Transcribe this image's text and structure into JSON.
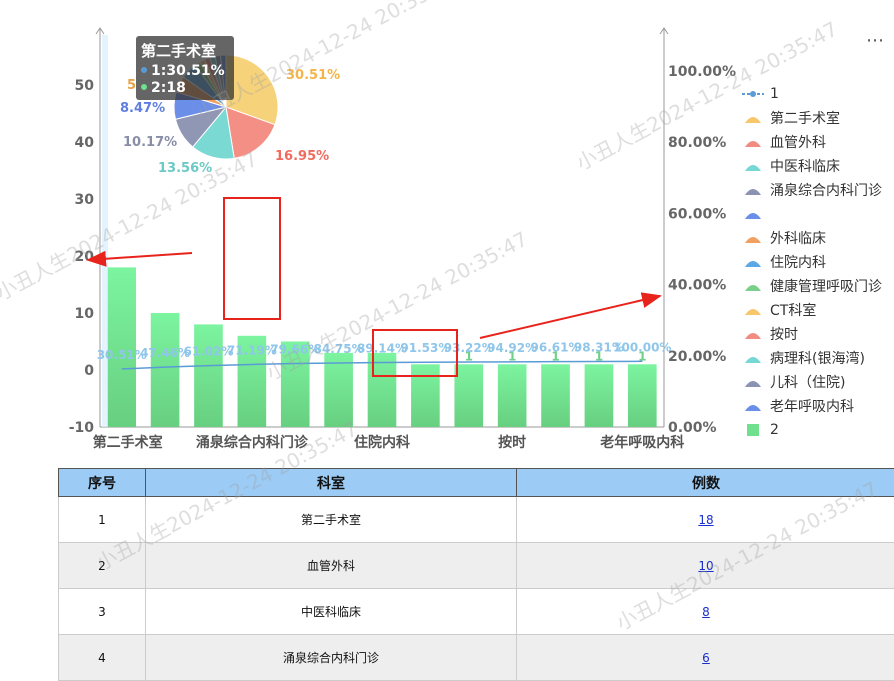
{
  "chart_data": {
    "type": "bar",
    "categories": [
      "第二手术室",
      "血管外科",
      "中医科临床",
      "涌泉综合内科门诊",
      "",
      "外科临床",
      "住院内科",
      "健康管理呼吸门诊",
      "CT科室",
      "按时",
      "病理科(银海湾)",
      "儿科（住院)",
      "老年呼吸内科"
    ],
    "x_tick_labels": [
      "第二手术室",
      "涌泉综合内科门诊",
      "住院内科",
      "按时",
      "老年呼吸内科"
    ],
    "series": [
      {
        "name": "1",
        "type": "line",
        "values": [
          30.51,
          47.46,
          61.02,
          71.19,
          79.66,
          84.75,
          89.14,
          91.53,
          93.22,
          94.92,
          96.61,
          98.31,
          100.0
        ],
        "labels": [
          "30.51%",
          "47.46%",
          "61.02%",
          "71.19%",
          "79.66%",
          "84.75%",
          "89.14%",
          "91.53%",
          "93.22%",
          "94.92%",
          "96.61%",
          "98.31%",
          "100.00%"
        ]
      },
      {
        "name": "2",
        "type": "bar",
        "values": [
          18,
          10,
          8,
          6,
          5,
          3,
          3,
          1,
          1,
          1,
          1,
          1,
          1
        ],
        "top_labels": [
          "",
          "",
          "",
          "",
          "",
          "",
          "",
          "",
          "1",
          "1",
          "1",
          "1",
          "1"
        ]
      }
    ],
    "y_left": {
      "ticks": [
        "-10",
        "0",
        "10",
        "20",
        "30",
        "40",
        "50"
      ],
      "min": -10,
      "max": 55
    },
    "y_right": {
      "ticks": [
        "0.00%",
        "20.00%",
        "40.00%",
        "60.00%",
        "80.00%",
        "100.00%"
      ],
      "min": -1.0,
      "max": 105
    },
    "legend_placement": "right",
    "pie_inset": {
      "labels": [
        "30.51%",
        "16.95%",
        "13.56%",
        "10.17%",
        "8.47%",
        "5"
      ],
      "slices": [
        30.51,
        16.95,
        13.56,
        10.17,
        8.47,
        5.08,
        5.08,
        1.69,
        1.69,
        1.69,
        1.69,
        1.69,
        1.69
      ]
    },
    "tooltip": {
      "title": "第二手术室",
      "line1": "1:30.51%",
      "line2": "2:18"
    }
  },
  "legend": [
    {
      "label": "1",
      "color": "#5b9bd5",
      "shape": "line"
    },
    {
      "label": "第二手术室",
      "color": "#f6c86b",
      "shape": "round"
    },
    {
      "label": "血管外科",
      "color": "#f28b82",
      "shape": "round"
    },
    {
      "label": "中医科临床",
      "color": "#76d7d4",
      "shape": "round"
    },
    {
      "label": "涌泉综合内科门诊",
      "color": "#8b93b5",
      "shape": "round"
    },
    {
      "label": "",
      "color": "#6b8fe8",
      "shape": "round"
    },
    {
      "label": "外科临床",
      "color": "#f0a060",
      "shape": "round"
    },
    {
      "label": "住院内科",
      "color": "#5aa8e6",
      "shape": "round"
    },
    {
      "label": "健康管理呼吸门诊",
      "color": "#7ccf8a",
      "shape": "round"
    },
    {
      "label": "CT科室",
      "color": "#f6c86b",
      "shape": "round"
    },
    {
      "label": "按时",
      "color": "#f28b82",
      "shape": "round"
    },
    {
      "label": "病理科(银海湾)",
      "color": "#76d7d4",
      "shape": "round"
    },
    {
      "label": "儿科（住院)",
      "color": "#8b93b5",
      "shape": "round"
    },
    {
      "label": "老年呼吸内科",
      "color": "#6b8fe8",
      "shape": "round"
    },
    {
      "label": "2",
      "color": "#6fe08e",
      "shape": "square"
    }
  ],
  "more_icon": "more-icon",
  "table": {
    "headers": [
      "序号",
      "科室",
      "例数"
    ],
    "rows": [
      {
        "no": "1",
        "dept": "第二手术室",
        "count": "18"
      },
      {
        "no": "2",
        "dept": "血管外科",
        "count": "10"
      },
      {
        "no": "3",
        "dept": "中医科临床",
        "count": "8"
      },
      {
        "no": "4",
        "dept": "涌泉综合内科门诊",
        "count": "6"
      }
    ]
  },
  "watermark": "小丑人生2024-12-24 20:35:47",
  "colors": {
    "bar_top": "#7cf4a0",
    "bar_bottom": "#67cf80",
    "line": "#5b9bd5",
    "header_bg": "#9ccbf5",
    "annotation": "#e8231b"
  }
}
